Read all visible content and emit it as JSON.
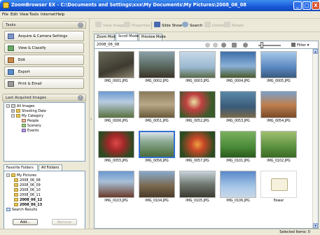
{
  "window": {
    "title": "ZoomBrowser EX   -  C:\\Documents and Settings\\xxx\\My Documents\\My Pictures\\2008_06_08",
    "controls": {
      "minimize": "_",
      "maximize": "□",
      "close": "X"
    }
  },
  "menu": [
    "File",
    "Edit",
    "View",
    "Tools",
    "Internet",
    "Help"
  ],
  "tasks": {
    "header": "Tasks",
    "collapse_icon": "chevron-up",
    "items": [
      {
        "label": "Acquire & Camera Settings",
        "icon": "camera-icon"
      },
      {
        "label": "View & Classify",
        "icon": "view-icon"
      },
      {
        "label": "Edit",
        "icon": "edit-icon"
      },
      {
        "label": "Export",
        "icon": "export-icon"
      },
      {
        "label": "Print & Email",
        "icon": "print-icon"
      }
    ]
  },
  "last_acquired": {
    "header": "Last Acquired Images",
    "tree": [
      {
        "label": "All Images",
        "toggle": "−",
        "level": 0
      },
      {
        "label": "Shooting Date",
        "toggle": "+",
        "level": 1
      },
      {
        "label": "My Category",
        "toggle": "−",
        "level": 1
      },
      {
        "label": "People",
        "toggle": "",
        "level": 2
      },
      {
        "label": "Scenery",
        "toggle": "",
        "level": 2
      },
      {
        "label": "Events",
        "toggle": "",
        "level": 2
      }
    ]
  },
  "folders": {
    "tabs": [
      "Favorite Folders",
      "All Folders"
    ],
    "active_tab": 0,
    "tree": [
      {
        "label": "My Pictures",
        "toggle": "−",
        "level": 0,
        "bold": false
      },
      {
        "label": "2008_06_08",
        "toggle": "",
        "level": 1,
        "bold": false,
        "selected": true
      },
      {
        "label": "2008_06_09",
        "toggle": "",
        "level": 1,
        "bold": false
      },
      {
        "label": "2008_06_10",
        "toggle": "",
        "level": 1,
        "bold": false
      },
      {
        "label": "2008_06_11",
        "toggle": "",
        "level": 1,
        "bold": false
      },
      {
        "label": "2008_06_12",
        "toggle": "",
        "level": 1,
        "bold": true
      },
      {
        "label": "2008_06_13",
        "toggle": "",
        "level": 1,
        "bold": true
      },
      {
        "label": "Search Results",
        "toggle": "",
        "level": 0,
        "bold": false
      }
    ],
    "add_label": "Add...",
    "remove_label": "Remove"
  },
  "toolbar": {
    "view_image": "View Image",
    "properties": "Properties",
    "slide_show": "Slide Show",
    "search": "Search",
    "delete": "Delete",
    "rotate": "Rotate"
  },
  "mode_tabs": [
    "Zoom Mode",
    "Scroll Mode",
    "Preview Mode"
  ],
  "active_mode": 1,
  "view": {
    "breadcrumb": "2008_06_08",
    "filter_label": "Filter",
    "thumbnail_size_level": 0.1
  },
  "thumbnails": [
    {
      "name": "IMG_0001.JPG",
      "scene": "dog"
    },
    {
      "name": "IMG_0002.JPG",
      "scene": "bird-rocks"
    },
    {
      "name": "IMG_0003.JPG",
      "scene": "eagle"
    },
    {
      "name": "IMG_0004.JPG",
      "scene": "sky"
    },
    {
      "name": "IMG_0005.JPG",
      "scene": "heron"
    },
    {
      "name": "IMG_0006.JPG",
      "scene": "landscape"
    },
    {
      "name": "IMG_0051.JPG",
      "scene": "goat"
    },
    {
      "name": "IMG_0052.JPG",
      "scene": "flowers"
    },
    {
      "name": "IMG_0053.JPG",
      "scene": "dog-water"
    },
    {
      "name": "IMG_0054.JPG",
      "scene": "canyon"
    },
    {
      "name": "IMG_0055.JPG",
      "scene": "red-flowers"
    },
    {
      "name": "IMG_0056.JPG",
      "scene": "tree",
      "selected": true
    },
    {
      "name": "IMG_0057.JPG",
      "scene": "flowers2"
    },
    {
      "name": "IMG_0101.JPG",
      "scene": "green"
    },
    {
      "name": "IMG_0102.JPG",
      "scene": "green2"
    },
    {
      "name": "IMG_0103.JPG",
      "scene": "house"
    },
    {
      "name": "IMG_0104.JPG",
      "scene": "shrine"
    },
    {
      "name": "IMG_0105.JPG",
      "scene": "temple"
    },
    {
      "name": "IMG_0106.JPG",
      "scene": "sky-blue"
    },
    {
      "name": "flower",
      "scene": "folder"
    }
  ],
  "status": {
    "selected_items": "Selected Items: 0"
  }
}
